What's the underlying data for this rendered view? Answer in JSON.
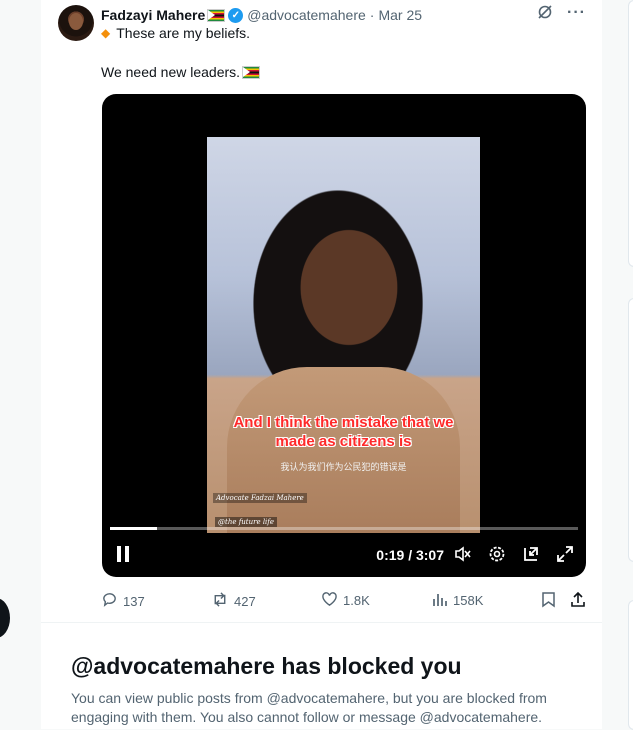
{
  "tweet": {
    "author_name": "Fadzayi Mahere",
    "handle": "@advocatemahere",
    "separator": "·",
    "date": "Mar 25",
    "line1": "These are my beliefs.",
    "line2": "We need new leaders.",
    "video": {
      "caption": "And I think the mistake that we made as citizens is",
      "subtitle_cn": "我认为我们作为公民犯的错误是",
      "watermark1": "Advocate Fadzai Mahere",
      "watermark2": "@the future life",
      "time": "0:19 / 3:07",
      "progress_fraction": 0.1
    },
    "actions": {
      "replies": "137",
      "reposts": "427",
      "likes": "1.8K",
      "views": "158K"
    }
  },
  "blocked": {
    "title": "@advocatemahere has blocked you",
    "body": "You can view public posts from @advocatemahere, but you are blocked from engaging with them. You also cannot follow or message @advocatemahere."
  },
  "icons": {
    "grok": "grok-icon",
    "more": "more-icon",
    "reply": "reply-icon",
    "repost": "repost-icon",
    "like": "like-icon",
    "views": "views-icon",
    "bookmark": "bookmark-icon",
    "share": "share-icon"
  },
  "colors": {
    "verified": "#1d9bf0",
    "caption_red": "#ff2a2a",
    "muted": "#536471"
  }
}
